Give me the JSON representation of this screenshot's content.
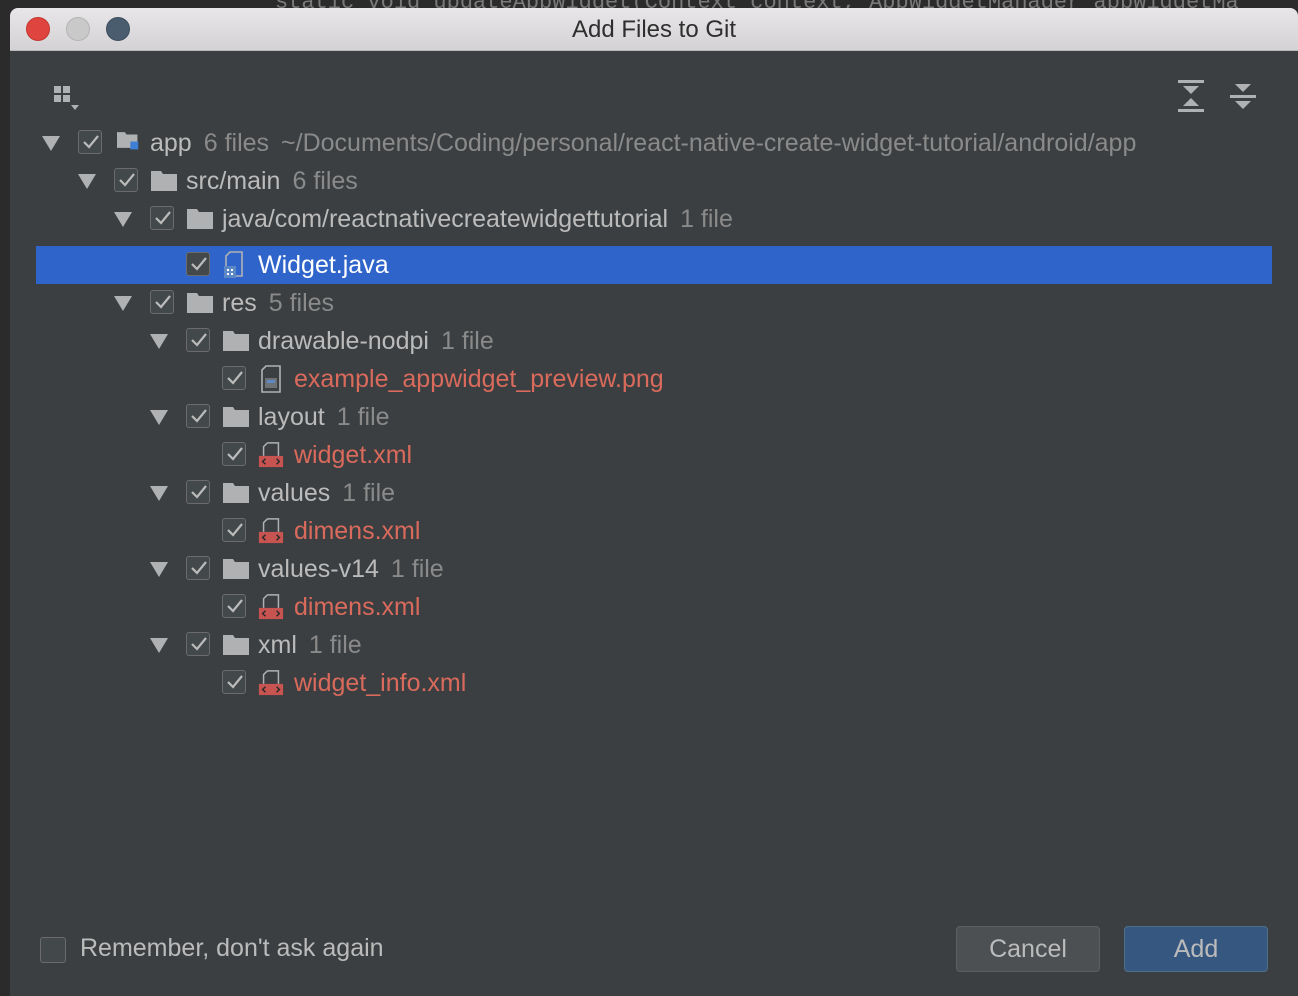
{
  "background_code": "static void updateAppWidget(Context context, AppWidgetManager appWidgetMa",
  "window": {
    "title": "Add Files to Git"
  },
  "toolbar": {
    "group_icon": "group-by-icon",
    "expand_icon": "expand-all-icon",
    "collapse_icon": "collapse-all-icon"
  },
  "tree": {
    "rows": [
      {
        "name": "app",
        "count": "6 files",
        "path": "~/Documents/Coding/personal/react-native-create-widget-tutorial/android/app",
        "type": "module"
      },
      {
        "name": "src/main",
        "count": "6 files",
        "type": "folder"
      },
      {
        "name": "java/com/reactnativecreatewidgettutorial",
        "count": "1 file",
        "type": "folder"
      },
      {
        "name": "Widget.java",
        "type": "java",
        "selected": true
      },
      {
        "name": "res",
        "count": "5 files",
        "type": "folder"
      },
      {
        "name": "drawable-nodpi",
        "count": "1 file",
        "type": "folder"
      },
      {
        "name": "example_appwidget_preview.png",
        "type": "image",
        "unversioned": true
      },
      {
        "name": "layout",
        "count": "1 file",
        "type": "folder"
      },
      {
        "name": "widget.xml",
        "type": "xml",
        "unversioned": true
      },
      {
        "name": "values",
        "count": "1 file",
        "type": "folder"
      },
      {
        "name": "dimens.xml",
        "type": "xml",
        "unversioned": true
      },
      {
        "name": "values-v14",
        "count": "1 file",
        "type": "folder"
      },
      {
        "name": "dimens.xml",
        "type": "xml",
        "unversioned": true
      },
      {
        "name": "xml",
        "count": "1 file",
        "type": "folder"
      },
      {
        "name": "widget_info.xml",
        "type": "xml",
        "unversioned": true
      }
    ]
  },
  "footer": {
    "remember_label": "Remember, don't ask again",
    "cancel_label": "Cancel",
    "add_label": "Add"
  },
  "colors": {
    "dialog_bg": "#3c3f41",
    "selection": "#2f65ca",
    "unversioned_text": "#d96a5c",
    "text": "#bbbbbb",
    "muted_text": "#8a8a8a"
  }
}
